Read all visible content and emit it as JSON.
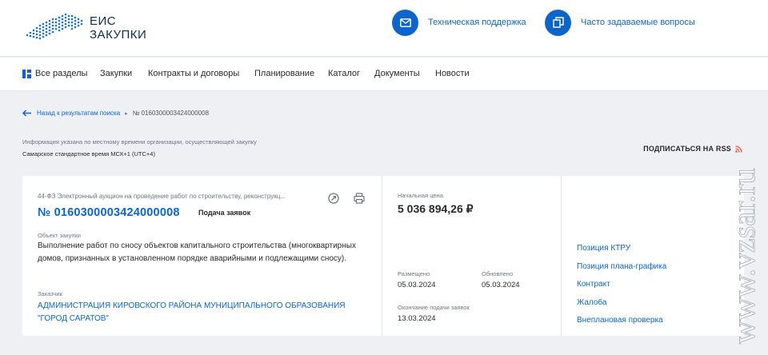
{
  "header": {
    "logo_line1": "ЕИС",
    "logo_line2": "ЗАКУПКИ",
    "support_label": "Техническая поддержка",
    "faq_label": "Часто задаваемые вопросы"
  },
  "nav": {
    "items": [
      "Все разделы",
      "Закупки",
      "Контракты и договоры",
      "Планирование",
      "Каталог",
      "Документы",
      "Новости"
    ]
  },
  "breadcrumb": {
    "back_label": "Назад к результатам поиска",
    "current": "№ 0160300003424000008"
  },
  "timezone": {
    "note": "Информация указана по местному времени организации, осуществляющей закупку",
    "value": "Самарское стандартное время МСК+1 (UTC+4)"
  },
  "rss_label": "ПОДПИСАТЬСЯ НА RSS",
  "card": {
    "law_type": "44-ФЗ Электронный аукцион на проведение работ по строительству, реконструкц...",
    "number": "№ 0160300003424000008",
    "stage": "Подача заявок",
    "object_label": "Объект закупки",
    "object_text": "Выполнение работ по сносу объектов капитального строительства (многоквартирных домов, признанных в установленном порядке аварийными и подлежащими сносу).",
    "customer_label": "Заказчик",
    "customer_name": "АДМИНИСТРАЦИЯ КИРОВСКОГО РАЙОНА МУНИЦИПАЛЬНОГО ОБРАЗОВАНИЯ \"ГОРОД САРАТОВ\"",
    "price_label": "Начальная цена",
    "price": "5 036 894,26 ₽",
    "posted_label": "Размещено",
    "posted": "05.03.2024",
    "updated_label": "Обновлено",
    "updated": "05.03.2024",
    "deadline_label": "Окончание подачи заявок",
    "deadline": "13.03.2024",
    "links": [
      "Позиция КТРУ",
      "Позиция плана-графика",
      "Контракт",
      "Жалоба",
      "Внеплановая проверка"
    ]
  },
  "watermark": "www.vzsar.ru",
  "colors": {
    "accent": "#0d65c9",
    "brand_dark": "#0d2b5a",
    "rss": "#e8553d"
  }
}
